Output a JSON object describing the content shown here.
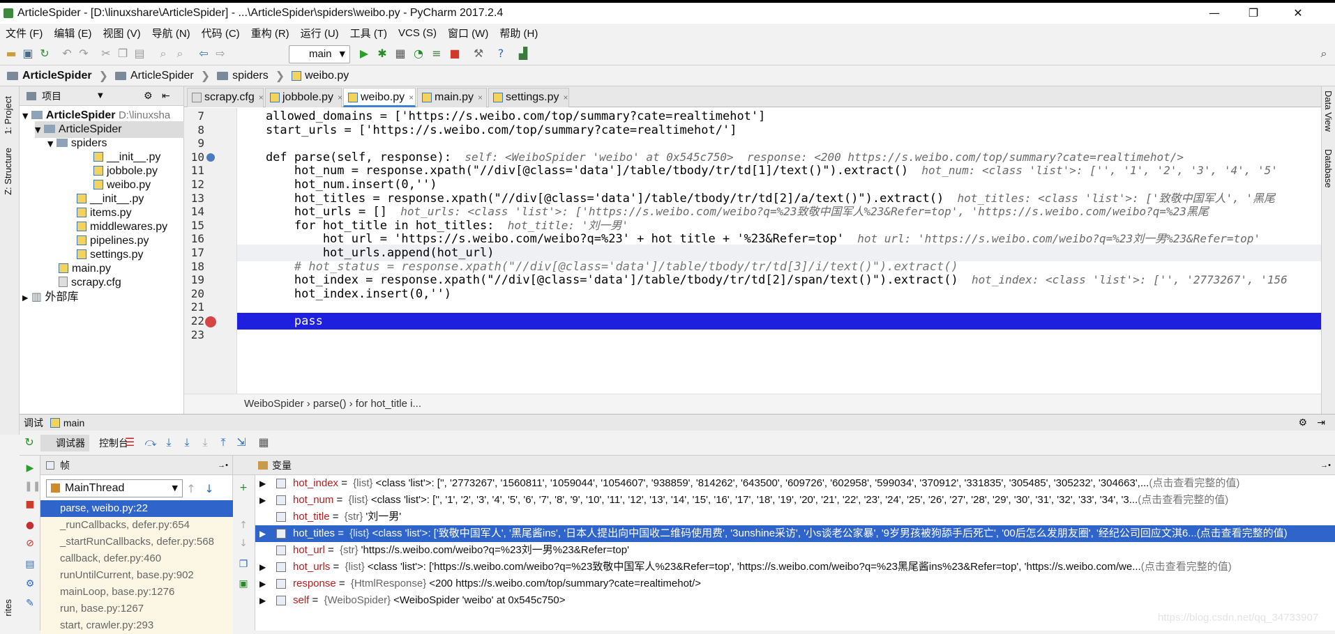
{
  "window": {
    "title": "ArticleSpider - [D:\\linuxshare\\ArticleSpider] - ...\\ArticleSpider\\spiders\\weibo.py - PyCharm 2017.2.4",
    "minimize": "—",
    "maximize": "❐",
    "close": "✕"
  },
  "menu": [
    "文件 (F)",
    "编辑 (E)",
    "视图 (V)",
    "导航 (N)",
    "代码 (C)",
    "重构 (R)",
    "运行 (U)",
    "工具 (T)",
    "VCS (S)",
    "窗口 (W)",
    "帮助 (H)"
  ],
  "toolbar": {
    "run_config": "main"
  },
  "breadcrumbs": [
    "ArticleSpider",
    "ArticleSpider",
    "spiders",
    "weibo.py"
  ],
  "side_tabs": {
    "project": "1: Project",
    "structure": "Z: Structure",
    "favorites": "rites",
    "data_view": "Data View",
    "database": "Database"
  },
  "project_panel": {
    "header": "项目",
    "items": [
      {
        "label": "ArticleSpider",
        "extra": "D:\\linuxsha",
        "kind": "folder",
        "bold": true
      },
      {
        "label": "ArticleSpider",
        "kind": "folder"
      },
      {
        "label": "spiders",
        "kind": "folder"
      },
      {
        "label": "__init__.py",
        "kind": "py"
      },
      {
        "label": "jobbole.py",
        "kind": "py"
      },
      {
        "label": "weibo.py",
        "kind": "py"
      },
      {
        "label": "__init__.py",
        "kind": "py"
      },
      {
        "label": "items.py",
        "kind": "py"
      },
      {
        "label": "middlewares.py",
        "kind": "py"
      },
      {
        "label": "pipelines.py",
        "kind": "py"
      },
      {
        "label": "settings.py",
        "kind": "py"
      },
      {
        "label": "main.py",
        "kind": "py"
      },
      {
        "label": "scrapy.cfg",
        "kind": "cfg"
      },
      {
        "label": "外部库",
        "kind": "lib"
      }
    ]
  },
  "editor_tabs": [
    {
      "label": "scrapy.cfg",
      "close": "×"
    },
    {
      "label": "jobbole.py",
      "close": "×"
    },
    {
      "label": "weibo.py",
      "close": "×"
    },
    {
      "label": "main.py",
      "close": "×"
    },
    {
      "label": "settings.py",
      "close": "×"
    }
  ],
  "code_lines": [
    {
      "num": "7",
      "code": "    allowed_domains = ['https://s.weibo.com/top/summary?cate=realtimehot']",
      "hint": ""
    },
    {
      "num": "8",
      "code": "    start_urls = ['https://s.weibo.com/top/summary?cate=realtimehot/']",
      "hint": ""
    },
    {
      "num": "9",
      "code": "",
      "hint": ""
    },
    {
      "num": "10",
      "code": "    def parse(self, response):",
      "hint": "  self: <WeiboSpider 'weibo' at 0x545c750>  response: <200 https://s.weibo.com/top/summary?cate=realtimehot/>"
    },
    {
      "num": "11",
      "code": "        hot_num = response.xpath(\"//div[@class='data']/table/tbody/tr/td[1]/text()\").extract()",
      "hint": "  hot_num: <class 'list'>: ['', '1', '2', '3', '4', '5'"
    },
    {
      "num": "12",
      "code": "        hot_num.insert(0,'')",
      "hint": ""
    },
    {
      "num": "13",
      "code": "        hot_titles = response.xpath(\"//div[@class='data']/table/tbody/tr/td[2]/a/text()\").extract()",
      "hint": "  hot_titles: <class 'list'>: ['致敬中国军人', '黑尾"
    },
    {
      "num": "14",
      "code": "        hot_urls = []",
      "hint": "  hot_urls: <class 'list'>: ['https://s.weibo.com/weibo?q=%23致敬中国军人%23&Refer=top', 'https://s.weibo.com/weibo?q=%23黑尾"
    },
    {
      "num": "15",
      "code": "        for hot_title in hot_titles:",
      "hint": "  hot_title: '刘一男'"
    },
    {
      "num": "16",
      "code": "            hot_url = 'https://s.weibo.com/weibo?q=%23' + hot_title + '%23&Refer=top'",
      "hint": "  hot_url: 'https://s.weibo.com/weibo?q=%23刘一男%23&Refer=top'"
    },
    {
      "num": "17",
      "code": "            hot_urls.append(hot_url)",
      "hint": ""
    },
    {
      "num": "18",
      "code": "        # hot_status = response.xpath(\"//div[@class='data']/table/tbody/tr/td[3]/i/text()\").extract()",
      "hint": ""
    },
    {
      "num": "19",
      "code": "        hot_index = response.xpath(\"//div[@class='data']/table/tbody/tr/td[2]/span/text()\").extract()",
      "hint": "  hot_index: <class 'list'>: ['', '2773267', '156"
    },
    {
      "num": "20",
      "code": "        hot_index.insert(0,'')",
      "hint": ""
    },
    {
      "num": "21",
      "code": "",
      "hint": ""
    },
    {
      "num": "22",
      "code": "        pass",
      "hint": ""
    },
    {
      "num": "23",
      "code": "",
      "hint": ""
    }
  ],
  "editor_breadcrumb": "WeiboSpider  ›  parse()  ›  for hot_title i...",
  "debug": {
    "title": "调试",
    "config": "main",
    "tab_debugger": "调试器",
    "tab_console": "控制台",
    "frames_header": "帧",
    "thread": "MainThread",
    "frames": [
      "parse, weibo.py:22",
      "_runCallbacks, defer.py:654",
      "_startRunCallbacks, defer.py:568",
      "callback, defer.py:460",
      "runUntilCurrent, base.py:902",
      "mainLoop, base.py:1276",
      "run, base.py:1267",
      "start, crawler.py:293"
    ],
    "variables_header": "变量",
    "variables": [
      {
        "name": "hot_index",
        "type": "{list}",
        "value": "<class 'list'>: ['', '2773267', '1560811', '1059044', '1054607', '938859', '814262', '643500', '609726', '602958', '599034', '370912', '331835', '305485', '305232', '304663',...",
        "link": "(点击查看完整的值)"
      },
      {
        "name": "hot_num",
        "type": "{list}",
        "value": "<class 'list'>: ['', '1', '2', '3', '4', '5', '6', '7', '8', '9', '10', '11', '12', '13', '14', '15', '16', '17', '18', '19', '20', '21', '22', '23', '24', '25', '26', '27', '28', '29', '30', '31', '32', '33', '34', '3...",
        "link": "(点击查看完整的值)"
      },
      {
        "name": "hot_title",
        "type": "{str}",
        "value": "'刘一男'",
        "link": ""
      },
      {
        "name": "hot_titles",
        "type": "{list}",
        "value": "<class 'list'>: ['致敬中国军人', '黑尾酱ins', '日本人提出向中国收二维码使用费', '3unshine采访', '小s谈老公家暴', '9岁男孩被狗舔手后死亡', '00后怎么发朋友圈', '经纪公司回应文淇6...",
        "link": "(点击查看完整的值)"
      },
      {
        "name": "hot_url",
        "type": "{str}",
        "value": "'https://s.weibo.com/weibo?q=%23刘一男%23&Refer=top'",
        "link": ""
      },
      {
        "name": "hot_urls",
        "type": "{list}",
        "value": "<class 'list'>: ['https://s.weibo.com/weibo?q=%23致敬中国军人%23&Refer=top', 'https://s.weibo.com/weibo?q=%23黑尾酱ins%23&Refer=top', 'https://s.weibo.com/we...",
        "link": "(点击查看完整的值)"
      },
      {
        "name": "response",
        "type": "{HtmlResponse}",
        "value": "<200 https://s.weibo.com/top/summary?cate=realtimehot/>",
        "link": ""
      },
      {
        "name": "self",
        "type": "{WeiboSpider}",
        "value": "<WeiboSpider 'weibo' at 0x545c750>",
        "link": ""
      }
    ]
  },
  "watermark": "https://blog.csdn.net/qq_34733907"
}
